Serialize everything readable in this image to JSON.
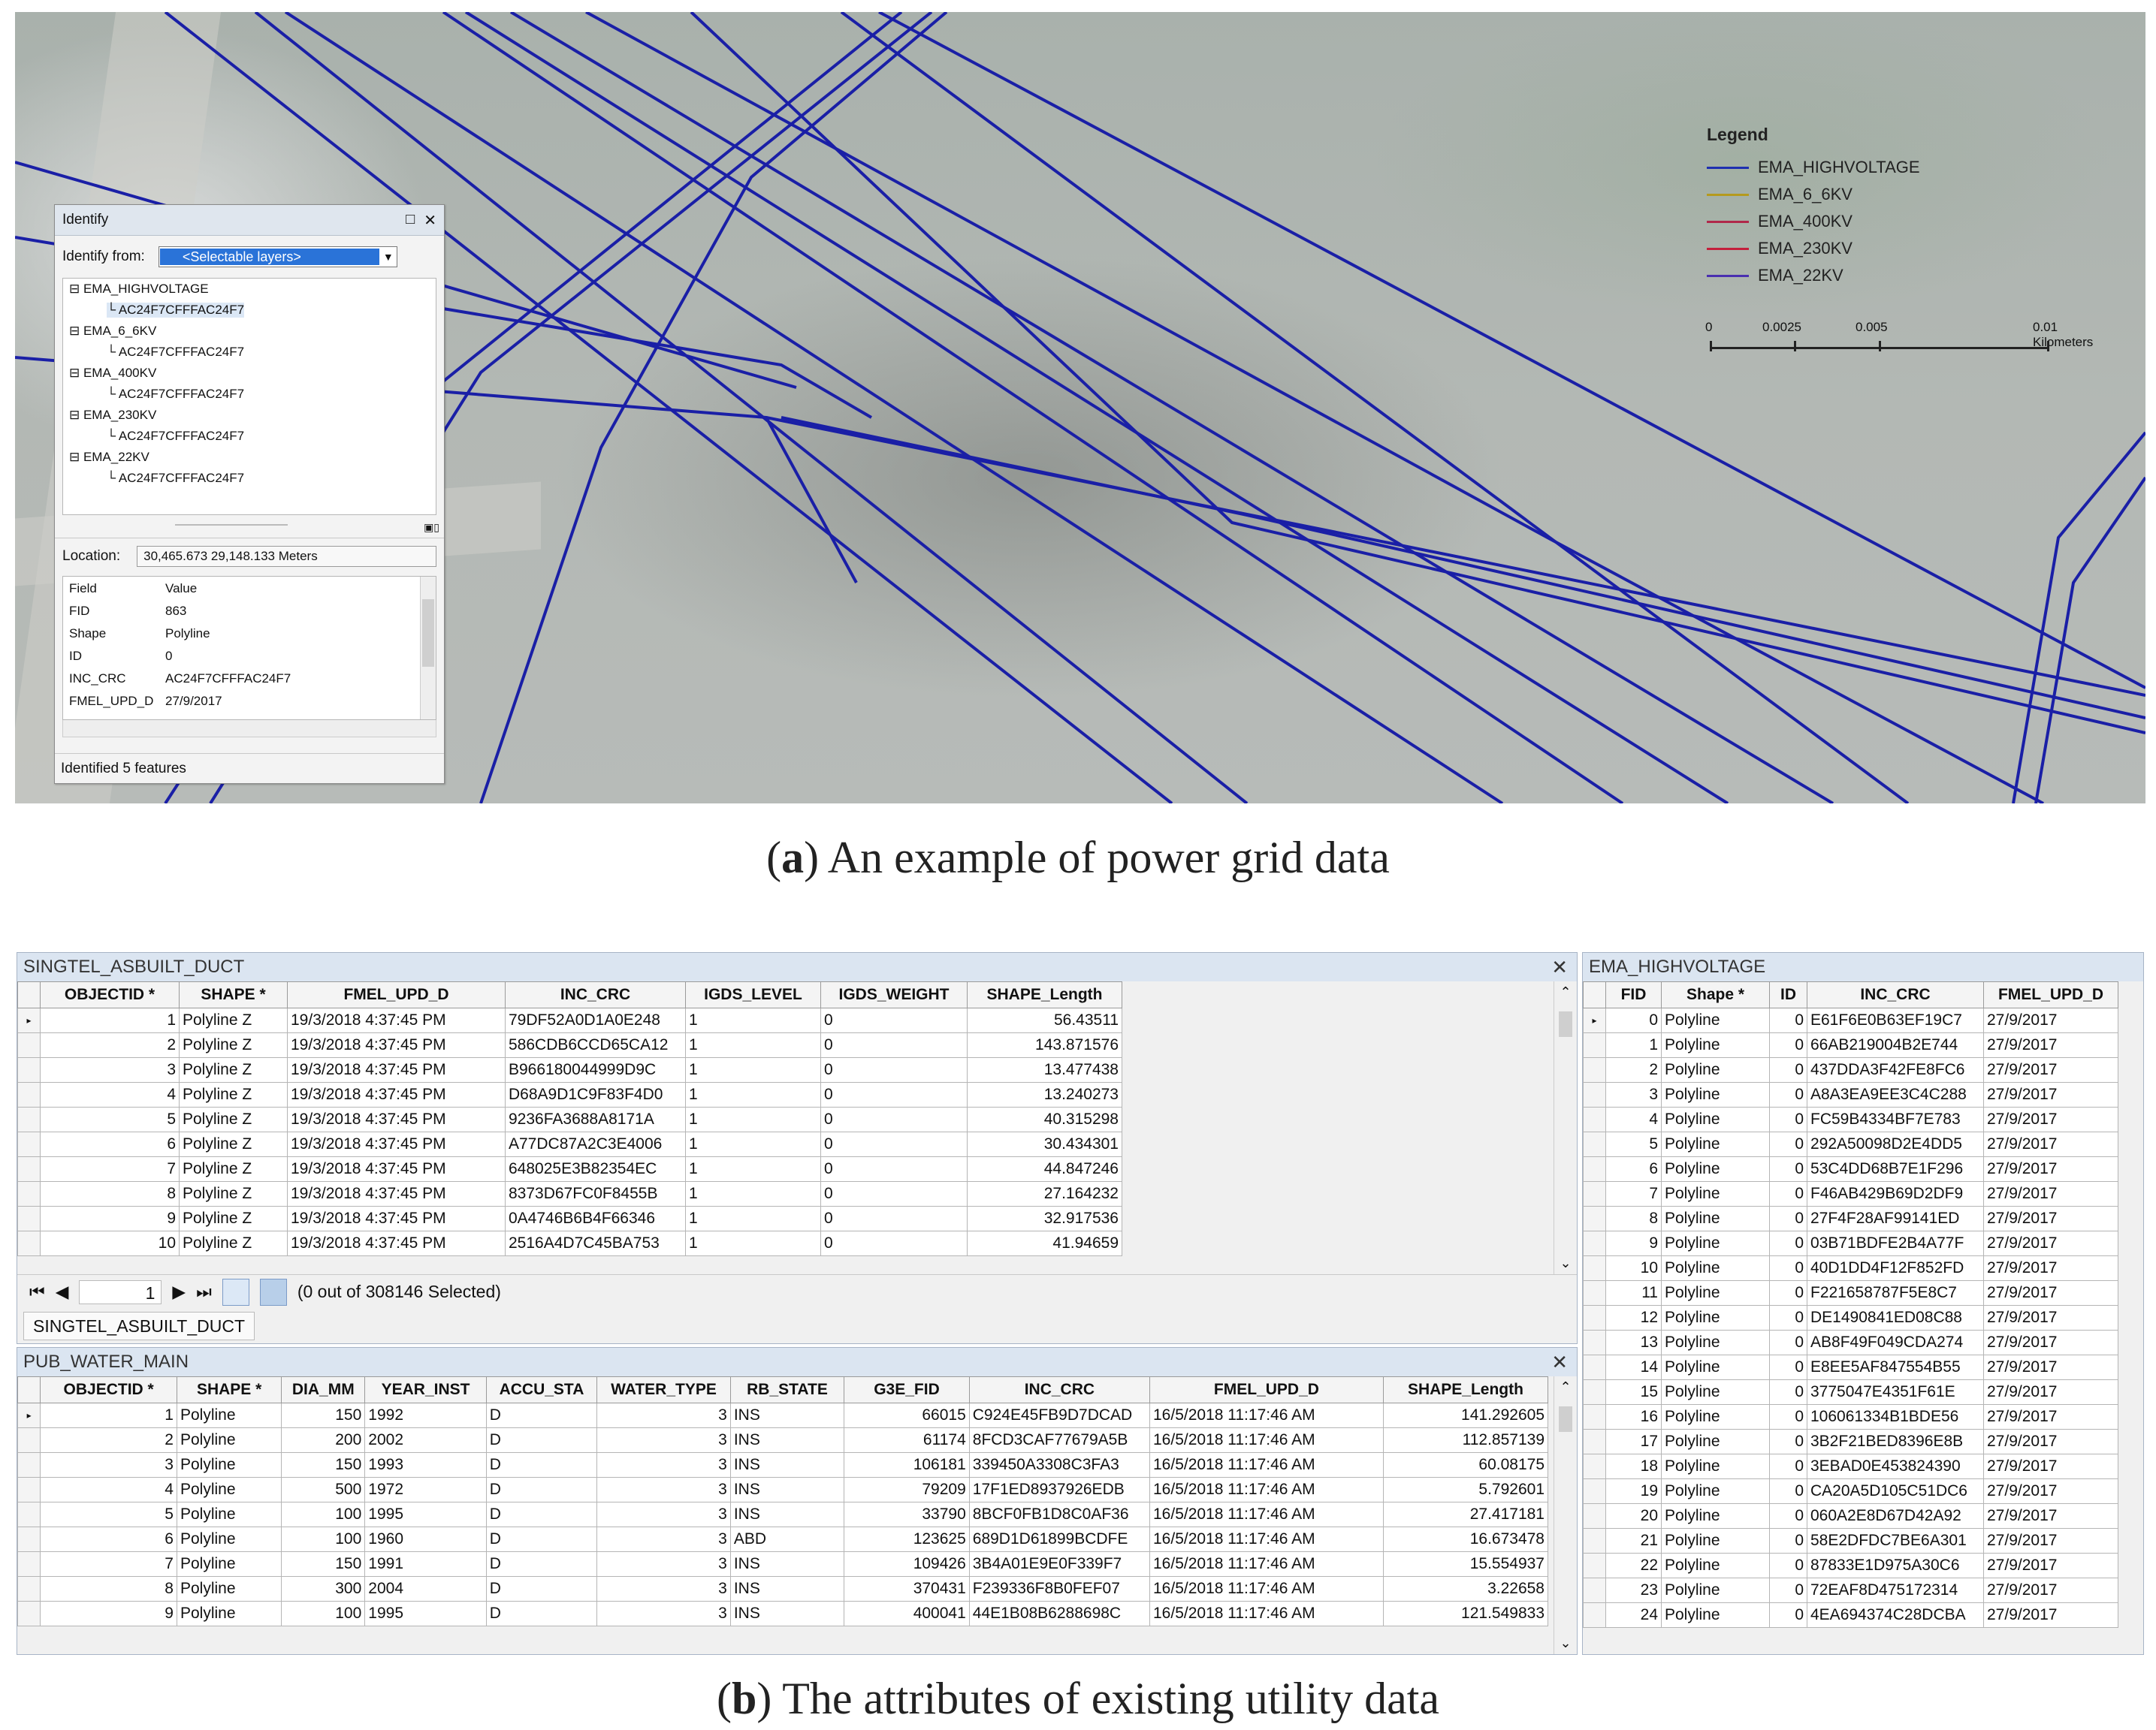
{
  "identify": {
    "title": "Identify",
    "restore_glyph": "□",
    "close_glyph": "✕",
    "from_label": "Identify from:",
    "from_value": "<Selectable layers>",
    "tree": [
      {
        "layer": "EMA_HIGHVOLTAGE",
        "feature": "AC24F7CFFFAC24F7"
      },
      {
        "layer": "EMA_6_6KV",
        "feature": "AC24F7CFFFAC24F7"
      },
      {
        "layer": "EMA_400KV",
        "feature": "AC24F7CFFFAC24F7"
      },
      {
        "layer": "EMA_230KV",
        "feature": "AC24F7CFFFAC24F7"
      },
      {
        "layer": "EMA_22KV",
        "feature": "AC24F7CFFFAC24F7"
      }
    ],
    "location_label": "Location:",
    "location_value": "30,465.673  29,148.133 Meters",
    "fields_header": {
      "field": "Field",
      "value": "Value"
    },
    "fields": [
      {
        "field": "FID",
        "value": "863"
      },
      {
        "field": "Shape",
        "value": "Polyline"
      },
      {
        "field": "ID",
        "value": "0"
      },
      {
        "field": "INC_CRC",
        "value": "AC24F7CFFFAC24F7"
      },
      {
        "field": "FMEL_UPD_D",
        "value": "27/9/2017"
      }
    ],
    "status": "Identified 5 features"
  },
  "legend": {
    "title": "Legend",
    "items": [
      {
        "label": "EMA_HIGHVOLTAGE",
        "color": "#1f2fb0"
      },
      {
        "label": "EMA_6_6KV",
        "color": "#b59a1e"
      },
      {
        "label": "EMA_400KV",
        "color": "#b0284a"
      },
      {
        "label": "EMA_230KV",
        "color": "#c4203c"
      },
      {
        "label": "EMA_22KV",
        "color": "#4a2fb0"
      }
    ],
    "scale": {
      "t0": "0",
      "t1": "0.0025",
      "t2": "0.005",
      "t3": "0.01 Kilometers"
    }
  },
  "caption_a": {
    "letter": "a",
    "text": " An example of power grid data"
  },
  "caption_b": {
    "letter": "b",
    "text": " The attributes of existing utility data"
  },
  "singtel": {
    "title": "SINGTEL_ASBUILT_DUCT",
    "close": "✕",
    "columns": [
      "OBJECTID *",
      "SHAPE *",
      "FMEL_UPD_D",
      "INC_CRC",
      "IGDS_LEVEL",
      "IGDS_WEIGHT",
      "SHAPE_Length"
    ],
    "rows": [
      [
        "1",
        "Polyline Z",
        "19/3/2018 4:37:45 PM",
        "79DF52A0D1A0E248",
        "1",
        "0",
        "56.43511"
      ],
      [
        "2",
        "Polyline Z",
        "19/3/2018 4:37:45 PM",
        "586CDB6CCD65CA12",
        "1",
        "0",
        "143.871576"
      ],
      [
        "3",
        "Polyline Z",
        "19/3/2018 4:37:45 PM",
        "B966180044999D9C",
        "1",
        "0",
        "13.477438"
      ],
      [
        "4",
        "Polyline Z",
        "19/3/2018 4:37:45 PM",
        "D68A9D1C9F83F4D0",
        "1",
        "0",
        "13.240273"
      ],
      [
        "5",
        "Polyline Z",
        "19/3/2018 4:37:45 PM",
        "9236FA3688A8171A",
        "1",
        "0",
        "40.315298"
      ],
      [
        "6",
        "Polyline Z",
        "19/3/2018 4:37:45 PM",
        "A77DC87A2C3E4006",
        "1",
        "0",
        "30.434301"
      ],
      [
        "7",
        "Polyline Z",
        "19/3/2018 4:37:45 PM",
        "648025E3B82354EC",
        "1",
        "0",
        "44.847246"
      ],
      [
        "8",
        "Polyline Z",
        "19/3/2018 4:37:45 PM",
        "8373D67FC0F8455B",
        "1",
        "0",
        "27.164232"
      ],
      [
        "9",
        "Polyline Z",
        "19/3/2018 4:37:45 PM",
        "0A4746B6B4F66346",
        "1",
        "0",
        "32.917536"
      ],
      [
        "10",
        "Polyline Z",
        "19/3/2018 4:37:45 PM",
        "2516A4D7C45BA753",
        "1",
        "0",
        "41.94659"
      ]
    ],
    "page": "1",
    "selected_text": "(0 out of 308146 Selected)",
    "tab": "SINGTEL_ASBUILT_DUCT"
  },
  "pub": {
    "title": "PUB_WATER_MAIN",
    "close": "✕",
    "columns": [
      "OBJECTID *",
      "SHAPE *",
      "DIA_MM",
      "YEAR_INST",
      "ACCU_STA",
      "WATER_TYPE",
      "RB_STATE",
      "G3E_FID",
      "INC_CRC",
      "FMEL_UPD_D",
      "SHAPE_Length"
    ],
    "rows": [
      [
        "1",
        "Polyline",
        "150",
        "1992",
        "D",
        "3",
        "INS",
        "66015",
        "C924E45FB9D7DCAD",
        "16/5/2018 11:17:46 AM",
        "141.292605"
      ],
      [
        "2",
        "Polyline",
        "200",
        "2002",
        "D",
        "3",
        "INS",
        "61174",
        "8FCD3CAF77679A5B",
        "16/5/2018 11:17:46 AM",
        "112.857139"
      ],
      [
        "3",
        "Polyline",
        "150",
        "1993",
        "D",
        "3",
        "INS",
        "106181",
        "339450A3308C3FA3",
        "16/5/2018 11:17:46 AM",
        "60.08175"
      ],
      [
        "4",
        "Polyline",
        "500",
        "1972",
        "D",
        "3",
        "INS",
        "79209",
        "17F1ED8937926EDB",
        "16/5/2018 11:17:46 AM",
        "5.792601"
      ],
      [
        "5",
        "Polyline",
        "100",
        "1995",
        "D",
        "3",
        "INS",
        "33790",
        "8BCF0FB1D8C0AF36",
        "16/5/2018 11:17:46 AM",
        "27.417181"
      ],
      [
        "6",
        "Polyline",
        "100",
        "1960",
        "D",
        "3",
        "ABD",
        "123625",
        "689D1D61899BCDFE",
        "16/5/2018 11:17:46 AM",
        "16.673478"
      ],
      [
        "7",
        "Polyline",
        "150",
        "1991",
        "D",
        "3",
        "INS",
        "109426",
        "3B4A01E9E0F339F7",
        "16/5/2018 11:17:46 AM",
        "15.554937"
      ],
      [
        "8",
        "Polyline",
        "300",
        "2004",
        "D",
        "3",
        "INS",
        "370431",
        "F239336F8B0FEF07",
        "16/5/2018 11:17:46 AM",
        "3.22658"
      ],
      [
        "9",
        "Polyline",
        "100",
        "1995",
        "D",
        "3",
        "INS",
        "400041",
        "44E1B08B6288698C",
        "16/5/2018 11:17:46 AM",
        "121.549833"
      ]
    ]
  },
  "ema": {
    "title": "EMA_HIGHVOLTAGE",
    "columns": [
      "FID",
      "Shape *",
      "ID",
      "INC_CRC",
      "FMEL_UPD_D"
    ],
    "rows": [
      [
        "0",
        "Polyline",
        "0",
        "E61F6E0B63EF19C7",
        "27/9/2017"
      ],
      [
        "1",
        "Polyline",
        "0",
        "66AB219004B2E744",
        "27/9/2017"
      ],
      [
        "2",
        "Polyline",
        "0",
        "437DDA3F42FE8FC6",
        "27/9/2017"
      ],
      [
        "3",
        "Polyline",
        "0",
        "A8A3EA9EE3C4C288",
        "27/9/2017"
      ],
      [
        "4",
        "Polyline",
        "0",
        "FC59B4334BF7E783",
        "27/9/2017"
      ],
      [
        "5",
        "Polyline",
        "0",
        "292A50098D2E4DD5",
        "27/9/2017"
      ],
      [
        "6",
        "Polyline",
        "0",
        "53C4DD68B7E1F296",
        "27/9/2017"
      ],
      [
        "7",
        "Polyline",
        "0",
        "F46AB429B69D2DF9",
        "27/9/2017"
      ],
      [
        "8",
        "Polyline",
        "0",
        "27F4F28AF99141ED",
        "27/9/2017"
      ],
      [
        "9",
        "Polyline",
        "0",
        "03B71BDFE2B4A77F",
        "27/9/2017"
      ],
      [
        "10",
        "Polyline",
        "0",
        "40D1DD4F12F852FD",
        "27/9/2017"
      ],
      [
        "11",
        "Polyline",
        "0",
        "F221658787F5E8C7",
        "27/9/2017"
      ],
      [
        "12",
        "Polyline",
        "0",
        "DE1490841ED08C88",
        "27/9/2017"
      ],
      [
        "13",
        "Polyline",
        "0",
        "AB8F49F049CDA274",
        "27/9/2017"
      ],
      [
        "14",
        "Polyline",
        "0",
        "E8EE5AF847554B55",
        "27/9/2017"
      ],
      [
        "15",
        "Polyline",
        "0",
        "3775047E4351F61E",
        "27/9/2017"
      ],
      [
        "16",
        "Polyline",
        "0",
        "106061334B1BDE56",
        "27/9/2017"
      ],
      [
        "17",
        "Polyline",
        "0",
        "3B2F21BED8396E8B",
        "27/9/2017"
      ],
      [
        "18",
        "Polyline",
        "0",
        "3EBAD0E453824390",
        "27/9/2017"
      ],
      [
        "19",
        "Polyline",
        "0",
        "CA20A5D105C51DC6",
        "27/9/2017"
      ],
      [
        "20",
        "Polyline",
        "0",
        "060A2E8D67D42A92",
        "27/9/2017"
      ],
      [
        "21",
        "Polyline",
        "0",
        "58E2DFDC7BE6A301",
        "27/9/2017"
      ],
      [
        "22",
        "Polyline",
        "0",
        "87833E1D975A30C6",
        "27/9/2017"
      ],
      [
        "23",
        "Polyline",
        "0",
        "72EAF8D475172314",
        "27/9/2017"
      ],
      [
        "24",
        "Polyline",
        "0",
        "4EA694374C28DCBA",
        "27/9/2017"
      ]
    ]
  }
}
